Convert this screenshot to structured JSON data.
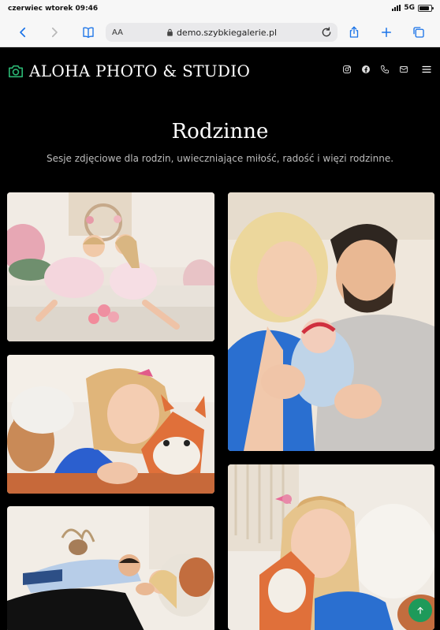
{
  "status_bar": {
    "time": "czerwiec wtorek 09:46",
    "network": "5G"
  },
  "browser": {
    "text_size_label": "AA",
    "url": "demo.szybkiegalerie.pl"
  },
  "site": {
    "logo_text": "ALOHA PHOTO & STUDIO",
    "accent_color": "#2bb673",
    "social_icons": [
      "instagram-icon",
      "facebook-icon",
      "phone-icon",
      "mail-icon"
    ],
    "menu_icon": "hamburger-menu-icon"
  },
  "page": {
    "title": "Rodzinne",
    "subtitle": "Sesje zdjęciowe dla rodzin, uwieczniające miłość, radość i więzi rodzinne."
  },
  "gallery": {
    "photos": [
      {
        "name": "photo-two-girls-on-bed"
      },
      {
        "name": "photo-couple-with-newborn"
      },
      {
        "name": "photo-girl-with-fox-toy"
      },
      {
        "name": "photo-couple-lying"
      },
      {
        "name": "photo-girl-with-fox-toy-closeup"
      }
    ]
  }
}
